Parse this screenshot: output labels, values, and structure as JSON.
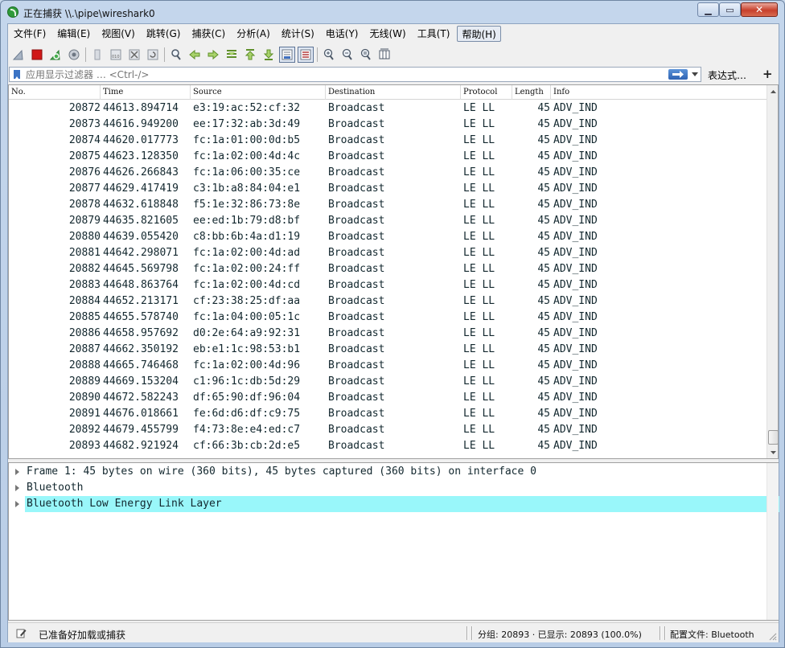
{
  "window": {
    "title": "正在捕获 \\\\.\\pipe\\wireshark0"
  },
  "menu": [
    "文件(F)",
    "编辑(E)",
    "视图(V)",
    "跳转(G)",
    "捕获(C)",
    "分析(A)",
    "统计(S)",
    "电话(Y)",
    "无线(W)",
    "工具(T)",
    "帮助(H)"
  ],
  "toolbar": {
    "icons": [
      "shark-fin-start-icon",
      "stop-capture-icon",
      "restart-capture-icon",
      "capture-options-icon",
      "open-file-icon",
      "save-file-icon",
      "close-file-icon",
      "reload-file-icon",
      "find-packet-icon",
      "go-back-icon",
      "go-forward-icon",
      "go-to-packet-icon",
      "go-first-icon",
      "go-last-icon",
      "auto-scroll-icon",
      "colorize-icon",
      "zoom-in-icon",
      "zoom-out-icon",
      "zoom-normal-icon",
      "resize-columns-icon"
    ]
  },
  "filter": {
    "placeholder": "应用显示过滤器 … <Ctrl-/>",
    "expression_label": "表达式…",
    "add_label": "+"
  },
  "columns": [
    "No.",
    "Time",
    "Source",
    "Destination",
    "Protocol",
    "Length",
    "Info"
  ],
  "packets": [
    {
      "no": "20872",
      "time": "44613.894714",
      "src": "e3:19:ac:52:cf:32",
      "dst": "Broadcast",
      "proto": "LE LL",
      "len": "45",
      "info": "ADV_IND"
    },
    {
      "no": "20873",
      "time": "44616.949200",
      "src": "ee:17:32:ab:3d:49",
      "dst": "Broadcast",
      "proto": "LE LL",
      "len": "45",
      "info": "ADV_IND"
    },
    {
      "no": "20874",
      "time": "44620.017773",
      "src": "fc:1a:01:00:0d:b5",
      "dst": "Broadcast",
      "proto": "LE LL",
      "len": "45",
      "info": "ADV_IND"
    },
    {
      "no": "20875",
      "time": "44623.128350",
      "src": "fc:1a:02:00:4d:4c",
      "dst": "Broadcast",
      "proto": "LE LL",
      "len": "45",
      "info": "ADV_IND"
    },
    {
      "no": "20876",
      "time": "44626.266843",
      "src": "fc:1a:06:00:35:ce",
      "dst": "Broadcast",
      "proto": "LE LL",
      "len": "45",
      "info": "ADV_IND"
    },
    {
      "no": "20877",
      "time": "44629.417419",
      "src": "c3:1b:a8:84:04:e1",
      "dst": "Broadcast",
      "proto": "LE LL",
      "len": "45",
      "info": "ADV_IND"
    },
    {
      "no": "20878",
      "time": "44632.618848",
      "src": "f5:1e:32:86:73:8e",
      "dst": "Broadcast",
      "proto": "LE LL",
      "len": "45",
      "info": "ADV_IND"
    },
    {
      "no": "20879",
      "time": "44635.821605",
      "src": "ee:ed:1b:79:d8:bf",
      "dst": "Broadcast",
      "proto": "LE LL",
      "len": "45",
      "info": "ADV_IND"
    },
    {
      "no": "20880",
      "time": "44639.055420",
      "src": "c8:bb:6b:4a:d1:19",
      "dst": "Broadcast",
      "proto": "LE LL",
      "len": "45",
      "info": "ADV_IND"
    },
    {
      "no": "20881",
      "time": "44642.298071",
      "src": "fc:1a:02:00:4d:ad",
      "dst": "Broadcast",
      "proto": "LE LL",
      "len": "45",
      "info": "ADV_IND"
    },
    {
      "no": "20882",
      "time": "44645.569798",
      "src": "fc:1a:02:00:24:ff",
      "dst": "Broadcast",
      "proto": "LE LL",
      "len": "45",
      "info": "ADV_IND"
    },
    {
      "no": "20883",
      "time": "44648.863764",
      "src": "fc:1a:02:00:4d:cd",
      "dst": "Broadcast",
      "proto": "LE LL",
      "len": "45",
      "info": "ADV_IND"
    },
    {
      "no": "20884",
      "time": "44652.213171",
      "src": "cf:23:38:25:df:aa",
      "dst": "Broadcast",
      "proto": "LE LL",
      "len": "45",
      "info": "ADV_IND"
    },
    {
      "no": "20885",
      "time": "44655.578740",
      "src": "fc:1a:04:00:05:1c",
      "dst": "Broadcast",
      "proto": "LE LL",
      "len": "45",
      "info": "ADV_IND"
    },
    {
      "no": "20886",
      "time": "44658.957692",
      "src": "d0:2e:64:a9:92:31",
      "dst": "Broadcast",
      "proto": "LE LL",
      "len": "45",
      "info": "ADV_IND"
    },
    {
      "no": "20887",
      "time": "44662.350192",
      "src": "eb:e1:1c:98:53:b1",
      "dst": "Broadcast",
      "proto": "LE LL",
      "len": "45",
      "info": "ADV_IND"
    },
    {
      "no": "20888",
      "time": "44665.746468",
      "src": "fc:1a:02:00:4d:96",
      "dst": "Broadcast",
      "proto": "LE LL",
      "len": "45",
      "info": "ADV_IND"
    },
    {
      "no": "20889",
      "time": "44669.153204",
      "src": "c1:96:1c:db:5d:29",
      "dst": "Broadcast",
      "proto": "LE LL",
      "len": "45",
      "info": "ADV_IND"
    },
    {
      "no": "20890",
      "time": "44672.582243",
      "src": "df:65:90:df:96:04",
      "dst": "Broadcast",
      "proto": "LE LL",
      "len": "45",
      "info": "ADV_IND"
    },
    {
      "no": "20891",
      "time": "44676.018661",
      "src": "fe:6d:d6:df:c9:75",
      "dst": "Broadcast",
      "proto": "LE LL",
      "len": "45",
      "info": "ADV_IND"
    },
    {
      "no": "20892",
      "time": "44679.455799",
      "src": "f4:73:8e:e4:ed:c7",
      "dst": "Broadcast",
      "proto": "LE LL",
      "len": "45",
      "info": "ADV_IND"
    },
    {
      "no": "20893",
      "time": "44682.921924",
      "src": "cf:66:3b:cb:2d:e5",
      "dst": "Broadcast",
      "proto": "LE LL",
      "len": "45",
      "info": "ADV_IND"
    }
  ],
  "details": [
    {
      "text": "Frame 1: 45 bytes on wire (360 bits), 45 bytes captured (360 bits) on interface 0",
      "selected": false
    },
    {
      "text": "Bluetooth",
      "selected": false
    },
    {
      "text": "Bluetooth Low Energy Link Layer",
      "selected": true
    }
  ],
  "status": {
    "ready": "已准备好加载或捕获",
    "stats": "分组: 20893 · 已显示: 20893 (100.0%)",
    "profile": "配置文件: Bluetooth"
  },
  "colors": {
    "selection_highlight": "#99f7fa",
    "stop_red": "#d01818",
    "fin_green": "#2f9a3a"
  }
}
